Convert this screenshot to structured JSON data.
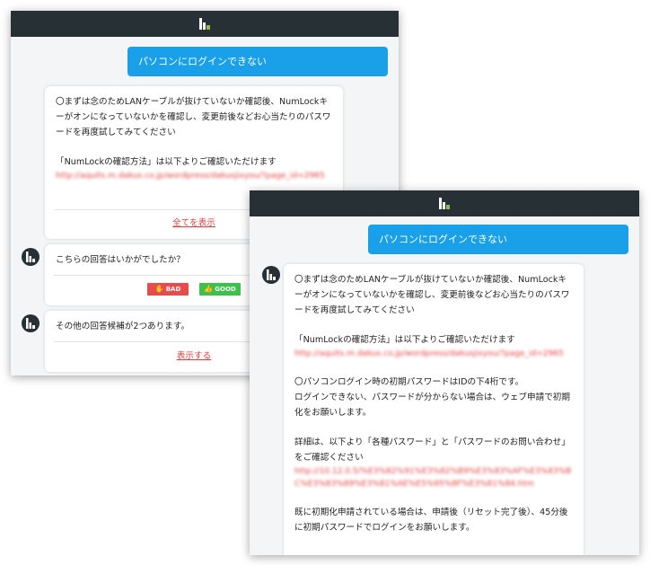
{
  "colors": {
    "topbar": "#273035",
    "user_bubble": "#1aa0e8",
    "link": "#e33e3e",
    "bad": "#e84b4b",
    "good": "#3cc24a"
  },
  "icons": {
    "app_logo": "app-logo-icon",
    "bot_avatar": "bot-avatar-icon",
    "bad": "thumbs-down-icon",
    "good": "thumbs-up-icon"
  },
  "back": {
    "user_message": "パソコンにログインできない",
    "answer": {
      "line1": "〇まずは念のためLANケーブルが抜けていないか確認後、NumLockキーがオンになっていないかを確認し、変更前後などお心当たりのパスワードを再度試してみてください",
      "line2": "「NumLockの確認方法」は以下よりご確認いただけます",
      "link": "http://aquits.m.dakus.co.jp/wordpress/dakusjixyou/?page_id=2965",
      "show_all": "全てを表示"
    },
    "feedback": {
      "question": "こちらの回答はいかがでしたか？",
      "bad_label": "BAD",
      "good_label": "GOOD"
    },
    "other": {
      "text": "その他の回答候補が2つあります。",
      "show": "表示する"
    }
  },
  "front": {
    "user_message": "パソコンにログインできない",
    "answer": {
      "p1": "〇まずは念のためLANケーブルが抜けていないか確認後、NumLockキーがオンになっていないかを確認し、変更前後などお心当たりのパスワードを再度試してみてください",
      "p2": "「NumLockの確認方法」は以下よりご確認いただけます",
      "link1": "http://aquits.m.dakus.co.jp/wordpress/dakusjixyou/?page_id=2965",
      "p3a": "〇パソコンログイン時の初期パスワードはIDの下4桁です。",
      "p3b": "ログインできない、パスワードが分からない場合は、ウェブ申請で初期化をお願いします。",
      "p4": "詳細は、以下より「各種パスワード」と「パスワードのお問い合わせ」をご確認ください",
      "link2": "http://10.12.0.5/%E3%82%91%E3%82%B9%E3%83%AF%E3%83%BC%E3%83%89%E3%81%AE%E5%95%8F%E3%81%84.htm",
      "p5": "既に初期化申請されている場合は、申請後（リセット完了後）、45分後に初期パスワードでログインをお願いします。"
    }
  }
}
